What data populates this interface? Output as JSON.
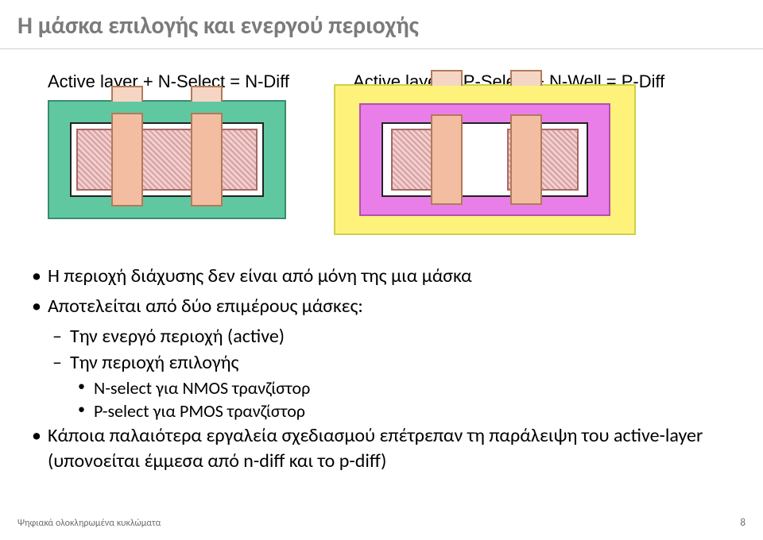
{
  "title": "Η μάσκα επιλογής και ενεργού περιοχής",
  "eq1": "Active layer  +  N-Select  =  N-Diff",
  "eq2": "Active layer  +  P-Select  +  N-Well  =  P-Diff",
  "bullets": {
    "b1": "Η περιοχή διάχυσης δεν είναι από μόνη της μια μάσκα",
    "b2": "Αποτελείται από δύο επιμέρους μάσκες:",
    "b2a": "Την ενεργό περιοχή (active)",
    "b2b": "Την περιοχή επιλογής",
    "b2b1": "N-select για NMOS τρανζίστορ",
    "b2b2": "P-select για PMOS τρανζίστορ",
    "b3": "Κάποια παλαιότερα εργαλεία σχεδιασμού επέτρεπαν τη παράλειψη του active-layer (υπονοείται έμμεσα από n-diff και το p-diff)"
  },
  "footer": {
    "left": "Ψηφιακά ολοκληρωμένα κυκλώματα",
    "page": "8"
  }
}
